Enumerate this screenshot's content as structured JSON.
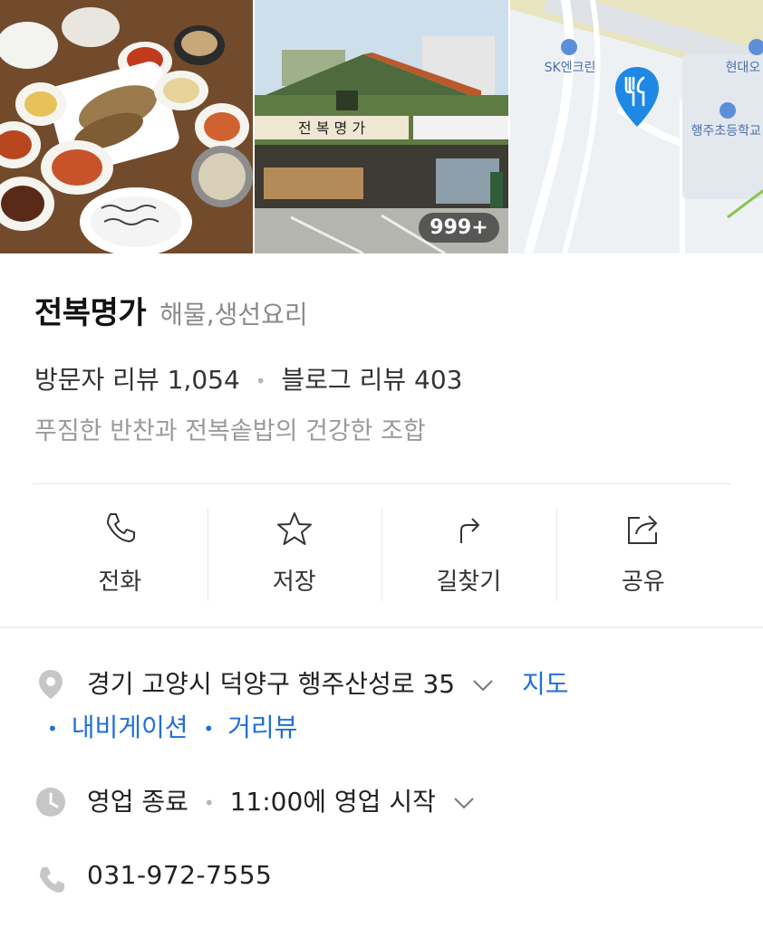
{
  "photos": {
    "count_badge": "999+",
    "map_labels": [
      "SK엔크린",
      "현대오",
      "행주초등학교"
    ]
  },
  "place": {
    "name": "전복명가",
    "category": "해물,생선요리",
    "visitor_review_label": "방문자 리뷰",
    "visitor_review_count": "1,054",
    "blog_review_label": "블로그 리뷰",
    "blog_review_count": "403",
    "tagline": "푸짐한 반찬과 전복솥밥의 건강한 조합"
  },
  "actions": [
    {
      "label": "전화",
      "icon": "phone-icon"
    },
    {
      "label": "저장",
      "icon": "star-icon"
    },
    {
      "label": "길찾기",
      "icon": "directions-icon"
    },
    {
      "label": "공유",
      "icon": "share-icon"
    }
  ],
  "details": {
    "address": "경기 고양시 덕양구 행주산성로 35",
    "map_link": "지도",
    "navigation_link": "내비게이션",
    "streetview_link": "거리뷰",
    "status": "영업 종료",
    "next_open": "11:00에 영업 시작",
    "phone": "031-972-7555"
  },
  "colors": {
    "link": "#1e6fd9",
    "muted": "#8a8a8a",
    "map_pin": "#1e88e5"
  }
}
